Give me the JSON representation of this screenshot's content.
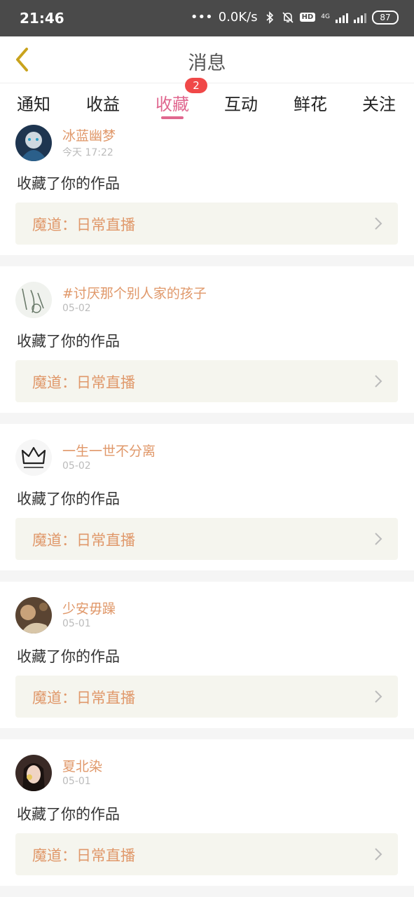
{
  "status_bar": {
    "time": "21:46",
    "net_speed": "0.0K/s",
    "hd": "HD",
    "net_type": "4G",
    "battery": "87"
  },
  "header": {
    "title": "消息",
    "back_icon": "chevron-left-icon"
  },
  "tabs": [
    {
      "label": "通知"
    },
    {
      "label": "收益"
    },
    {
      "label": "收藏",
      "active": true,
      "badge": "2"
    },
    {
      "label": "互动"
    },
    {
      "label": "鲜花"
    },
    {
      "label": "关注"
    }
  ],
  "messages": [
    {
      "user": "冰蓝幽梦",
      "time": "今天 17:22",
      "action": "收藏了你的作品",
      "work": "魔道：日常直播"
    },
    {
      "user": "#讨厌那个别人家的孩子",
      "time": "05-02",
      "action": "收藏了你的作品",
      "work": "魔道：日常直播"
    },
    {
      "user": "一生一世不分离",
      "time": "05-02",
      "action": "收藏了你的作品",
      "work": "魔道：日常直播"
    },
    {
      "user": "少安毋躁",
      "time": "05-01",
      "action": "收藏了你的作品",
      "work": "魔道：日常直播"
    },
    {
      "user": "夏北染",
      "time": "05-01",
      "action": "收藏了你的作品",
      "work": "魔道：日常直播"
    }
  ],
  "colors": {
    "accent": "#e0678f",
    "username": "#e0986a",
    "badge": "#f04848"
  }
}
